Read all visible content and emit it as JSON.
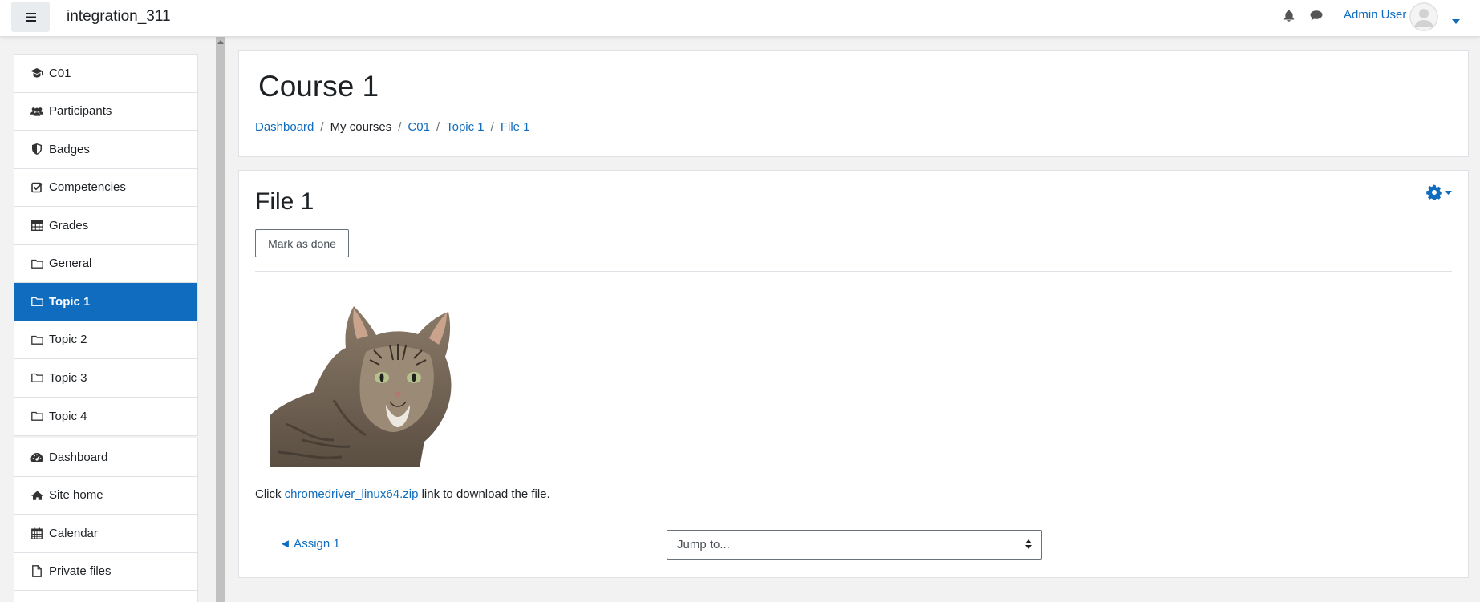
{
  "navbar": {
    "site_name": "integration_311",
    "user_name": "Admin User",
    "icons": [
      "hamburger-icon",
      "bell-icon",
      "chat-icon",
      "avatar",
      "caret-down-icon"
    ]
  },
  "sidebar": {
    "course_items": [
      {
        "label": "C01",
        "icon": "graduation-cap-icon"
      },
      {
        "label": "Participants",
        "icon": "users-icon"
      },
      {
        "label": "Badges",
        "icon": "shield-icon"
      },
      {
        "label": "Competencies",
        "icon": "check-square-icon"
      },
      {
        "label": "Grades",
        "icon": "table-icon"
      },
      {
        "label": "General",
        "icon": "folder-icon"
      },
      {
        "label": "Topic 1",
        "icon": "folder-icon",
        "active": true
      },
      {
        "label": "Topic 2",
        "icon": "folder-icon"
      },
      {
        "label": "Topic 3",
        "icon": "folder-icon"
      },
      {
        "label": "Topic 4",
        "icon": "folder-icon"
      }
    ],
    "site_items": [
      {
        "label": "Dashboard",
        "icon": "dashboard-icon"
      },
      {
        "label": "Site home",
        "icon": "home-icon"
      },
      {
        "label": "Calendar",
        "icon": "calendar-icon"
      },
      {
        "label": "Private files",
        "icon": "file-icon"
      }
    ]
  },
  "header": {
    "title": "Course 1",
    "breadcrumb": [
      "Dashboard",
      "My courses",
      "C01",
      "Topic 1",
      "File 1"
    ]
  },
  "content": {
    "title": "File 1",
    "mark_done": "Mark as done",
    "download_prefix": "Click ",
    "download_link": "chromedriver_linux64.zip",
    "download_suffix": " link to download the file.",
    "prev_activity": "◄ Assign 1",
    "jump_placeholder": "Jump to..."
  },
  "colors": {
    "accent": "#0f6cbf",
    "text": "#1d2125",
    "background": "#f2f2f2"
  }
}
